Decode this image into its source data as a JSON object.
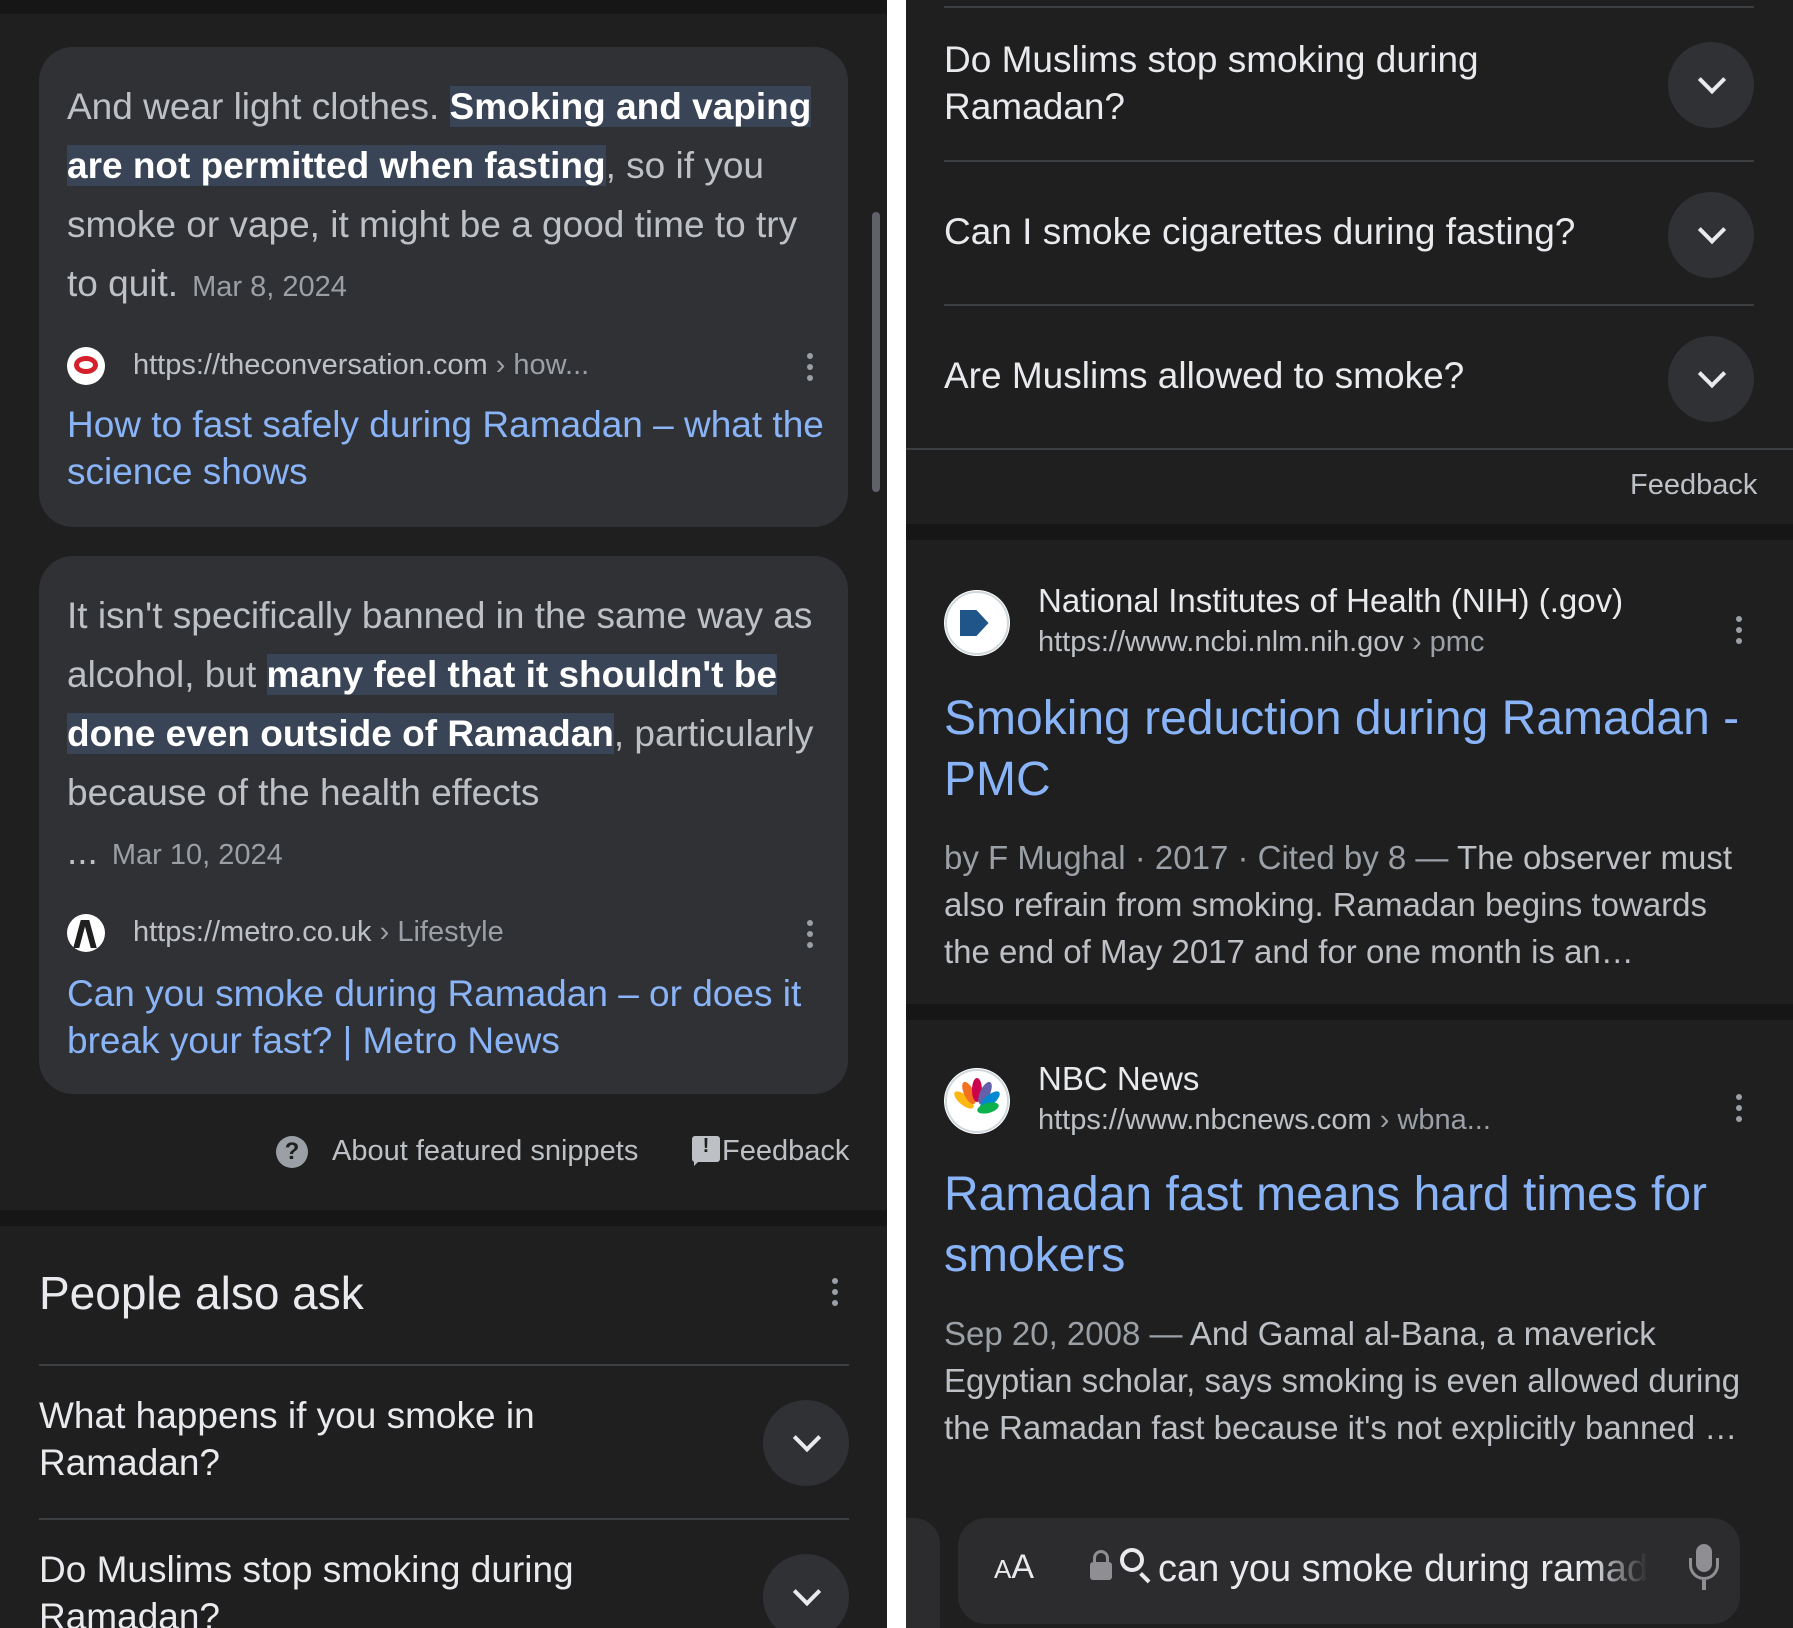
{
  "left": {
    "snippet1": {
      "text_before": "And wear light clothes. ",
      "highlight": "Smoking and vaping are not permitted when fasting",
      "text_after": ", so if you smoke or vape, it might be a good time to try to quit.",
      "date": "Mar 8, 2024",
      "url": "https://theconversation.com",
      "crumb": " › how...",
      "title": "How to fast safely during Ramadan – what the science shows"
    },
    "snippet2": {
      "text_before": "It isn't specifically banned in the same way as alcohol, but ",
      "highlight": "many feel that it shouldn't be done even outside of Ramadan",
      "text_after": ", particularly because of the health effects",
      "ellipsis": "...",
      "date": "Mar 10, 2024",
      "url": "https://metro.co.uk",
      "crumb": " › Lifestyle",
      "title": "Can you smoke during Ramadan – or does it break your fast? | Metro News"
    },
    "footer": {
      "help_glyph": "?",
      "about": "About featured snippets",
      "feedback": "Feedback"
    },
    "paa": {
      "title": "People also ask",
      "questions": [
        "What happens if you smoke in Ramadan?",
        "Do Muslims stop smoking during Ramadan?"
      ]
    }
  },
  "right": {
    "questions": [
      "Do Muslims stop smoking during Ramadan?",
      "Can I smoke cigarettes during fasting?",
      "Are Muslims allowed to smoke?"
    ],
    "feedback": "Feedback",
    "results": [
      {
        "site": "National Institutes of Health (NIH) (.gov)",
        "url": "https://www.ncbi.nlm.nih.gov",
        "crumb": " › pmc",
        "title": "Smoking reduction during Ramadan - PMC",
        "meta": "by F Mughal · 2017 · Cited by 8 — ",
        "snippet": "The observer must also refrain from smoking. Ramadan begins towards the end of May 2017 and for one month is an…"
      },
      {
        "site": "NBC News",
        "url": "https://www.nbcnews.com",
        "crumb": " › wbna...",
        "title": "Ramadan fast means hard times for smokers",
        "meta": "Sep 20, 2008 — ",
        "snippet": "And Gamal al-Bana, a maverick Egyptian scholar, says smoking is even allowed during the Ramadan fast because it's not explicitly banned …"
      }
    ],
    "urlbar": {
      "aa_big": "A",
      "aa_small": "A",
      "query": "can you smoke during ramadan"
    }
  },
  "colors": {
    "background": "#1f1f1f",
    "card": "#303134",
    "link": "#8ab4f8",
    "highlight_bg": "#394457",
    "text": "#bdc1c6"
  },
  "icons": [
    "conversation-favicon-icon",
    "metro-favicon-icon",
    "nih-favicon-icon",
    "nbc-peacock-icon",
    "help-icon",
    "feedback-icon",
    "chevron-down-icon",
    "more-vert-icon",
    "lock-icon",
    "search-icon",
    "mic-icon"
  ]
}
